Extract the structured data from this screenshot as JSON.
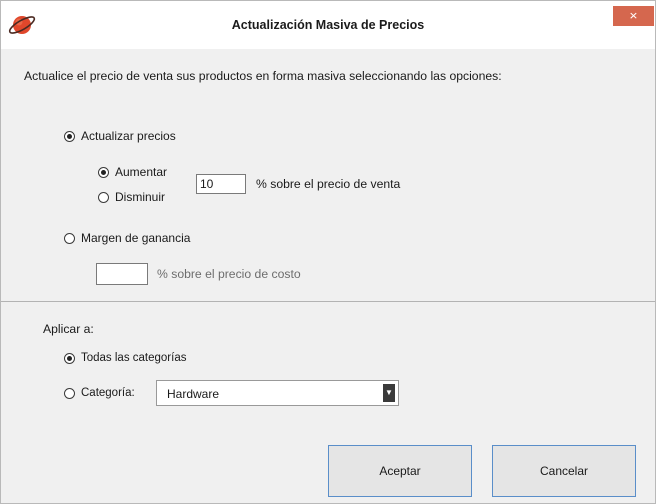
{
  "window": {
    "title": "Actualización Masiva de Precios",
    "close_glyph": "×",
    "app_icon": "planet-icon"
  },
  "intro_text": "Actualice el precio de venta sus productos en forma masiva seleccionando las opciones:",
  "update_prices": {
    "label": "Actualizar precios",
    "selected": true,
    "increase_label": "Aumentar",
    "increase_selected": true,
    "decrease_label": "Disminuir",
    "decrease_selected": false,
    "percent_value": "10",
    "percent_suffix": "% sobre el precio de venta"
  },
  "profit_margin": {
    "label": "Margen de ganancia",
    "selected": false,
    "percent_value": "",
    "percent_suffix": "% sobre el precio de costo"
  },
  "apply_to": {
    "heading": "Aplicar a:",
    "all_label": "Todas las categorías",
    "all_selected": true,
    "category_label": "Categoría:",
    "category_selected": false,
    "category_value": "Hardware"
  },
  "buttons": {
    "accept": "Aceptar",
    "cancel": "Cancelar"
  },
  "colors": {
    "close_button": "#d5674e",
    "button_border": "#5a8ec9",
    "planet": "#e0472b"
  }
}
